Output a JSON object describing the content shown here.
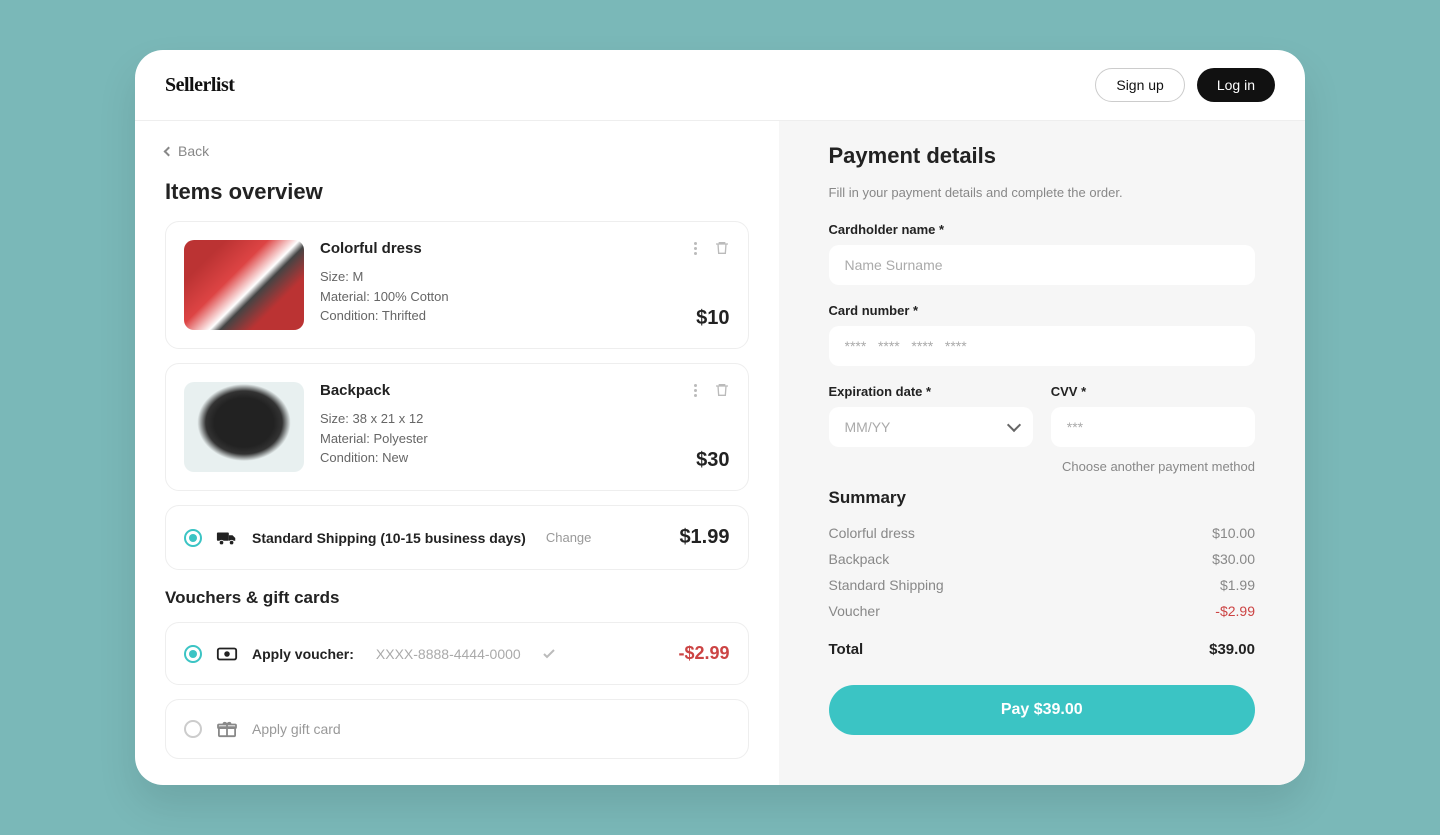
{
  "brand": "Sellerlist",
  "header": {
    "signup": "Sign up",
    "login": "Log in"
  },
  "back": "Back",
  "items_heading": "Items overview",
  "items": [
    {
      "title": "Colorful dress",
      "size": "Size: M",
      "material": "Material: 100% Cotton",
      "condition": "Condition: Thrifted",
      "price": "$10"
    },
    {
      "title": "Backpack",
      "size": "Size: 38 x 21 x 12",
      "material": "Material: Polyester",
      "condition": "Condition: New",
      "price": "$30"
    }
  ],
  "shipping": {
    "label": "Standard Shipping (10-15 business days)",
    "change": "Change",
    "price": "$1.99"
  },
  "vouchers_heading": "Vouchers & gift cards",
  "voucher": {
    "label": "Apply voucher:",
    "code": "XXXX-8888-4444-0000",
    "amount": "-$2.99"
  },
  "gift": {
    "label": "Apply gift card"
  },
  "payment": {
    "heading": "Payment details",
    "subtitle": "Fill in your payment details and complete the order.",
    "cardholder_label": "Cardholder name *",
    "cardholder_placeholder": "Name Surname",
    "cardnumber_label": "Card number *",
    "cardnumber_placeholder": "****   ****   ****   ****",
    "expiry_label": "Expiration date *",
    "expiry_placeholder": "MM/YY",
    "cvv_label": "CVV *",
    "cvv_placeholder": "***",
    "alt_method": "Choose another payment method"
  },
  "summary": {
    "heading": "Summary",
    "rows": [
      {
        "label": "Colorful dress",
        "value": "$10.00"
      },
      {
        "label": "Backpack",
        "value": "$30.00"
      },
      {
        "label": "Standard Shipping",
        "value": "$1.99"
      },
      {
        "label": "Voucher",
        "value": "-$2.99"
      }
    ],
    "total_label": "Total",
    "total_value": "$39.00"
  },
  "pay_button": "Pay $39.00"
}
